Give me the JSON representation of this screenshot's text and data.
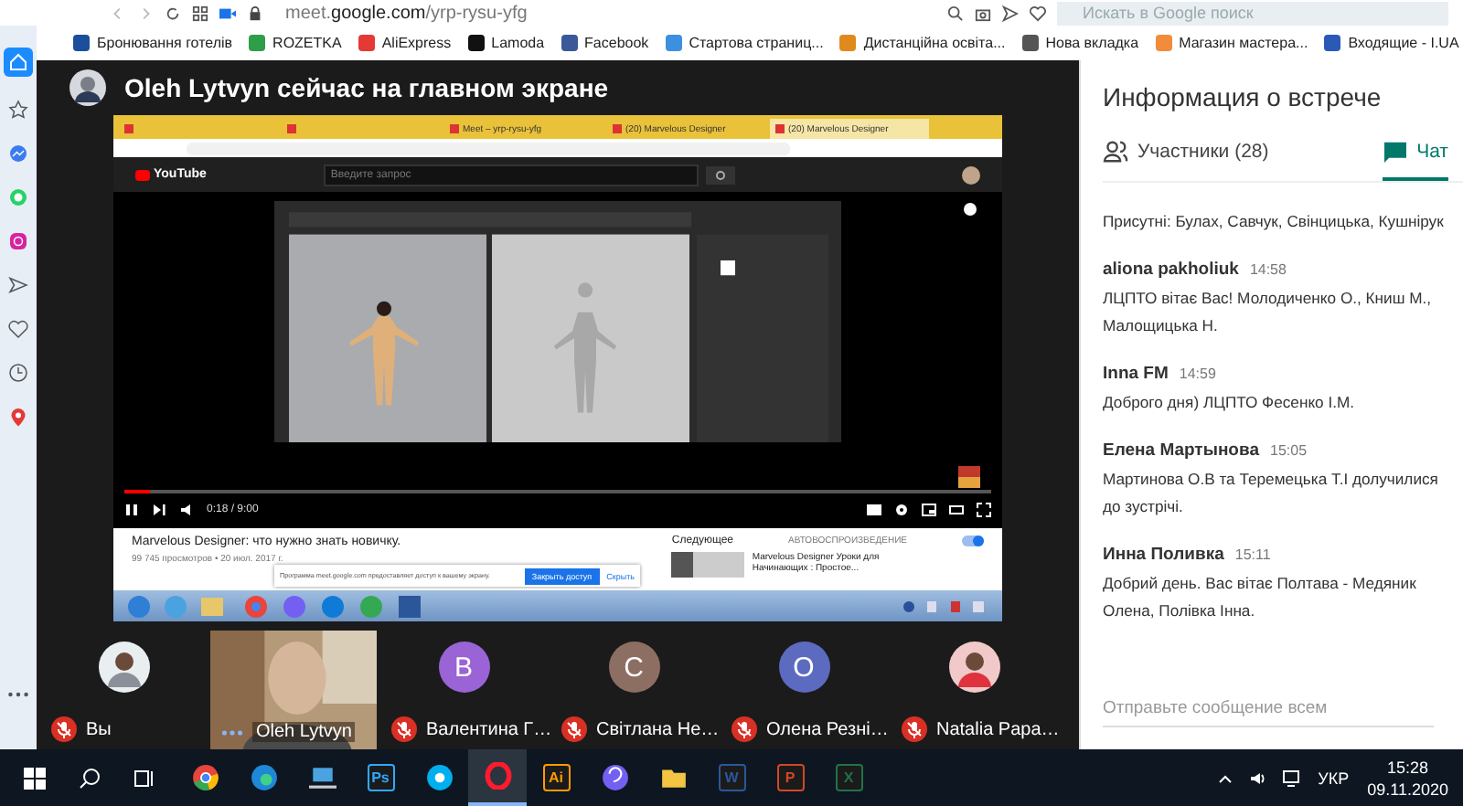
{
  "browser": {
    "address": "meet.**google.com**/yrp-rysu-yfg",
    "search_placeholder": "Искать в Google поиск"
  },
  "bookmarks": [
    {
      "label": "Бронювання готелів"
    },
    {
      "label": "ROZETKA"
    },
    {
      "label": "AliExpress"
    },
    {
      "label": "Lamoda"
    },
    {
      "label": "Facebook"
    },
    {
      "label": "Стартова страниц..."
    },
    {
      "label": "Дистанційна освіта..."
    },
    {
      "label": "Нова вкладка"
    },
    {
      "label": "Магазин мастера..."
    },
    {
      "label": "Входящие - I.UA"
    }
  ],
  "presenter": {
    "title": "Oleh Lytvyn сейчас на главном экране"
  },
  "shared_screen": {
    "tabs": [
      {
        "selected": false
      },
      {
        "selected": false
      },
      {
        "label": "Meet – yrp-rysu-yfg",
        "selected": false
      },
      {
        "label": "(20) Marvelous Designer",
        "selected": false
      },
      {
        "label": "(20) Marvelous Designer",
        "selected": true
      }
    ],
    "logo": "YouTube",
    "search_placeholder": "Введите запрос",
    "time": "0:18 / 9:00",
    "level": 0.03,
    "video_title": "Marvelous Designer: что нужно знать новичку.",
    "video_meta": "99 745 просмотров • 20 июл. 2017 г.",
    "up_next": "Следующее",
    "autoplay": "АВТОВОСПРОИЗВЕДЕНИЕ",
    "autoplay_on": true,
    "next_video": "Marvelous Designer Уроки для Начинающих : Простое...",
    "banner": {
      "text": "Программа meet.google.com предоставляет доступ к вашему экрану.",
      "stop": "Закрыть доступ",
      "hide": "Скрыть"
    }
  },
  "participants": [
    {
      "name": "Вы",
      "muted": true
    },
    {
      "name": "Oleh Lytvyn",
      "kind": "video",
      "muted": false
    },
    {
      "name": "Валентина Г…",
      "kind": "letter",
      "letter": "В",
      "color": "#9a63d6",
      "muted": true
    },
    {
      "name": "Світлана Не…",
      "kind": "letter",
      "letter": "С",
      "color": "#8d6e63",
      "muted": true
    },
    {
      "name": "Олена Резні…",
      "kind": "letter",
      "letter": "О",
      "color": "#5c6bc0",
      "muted": true
    },
    {
      "name": "Natalia Papa…",
      "muted": true
    }
  ],
  "panel": {
    "title": "Информация о встрече",
    "tabs": [
      {
        "label": "Участники (28)",
        "kind": "people",
        "selected": false
      },
      {
        "label": "Чат",
        "kind": "chat",
        "selected": true
      }
    ],
    "messages": [
      {
        "text": "Присутні: Булах, Савчук, Свінцицька, Кушнірук"
      },
      {
        "author": "aliona pakholiuk",
        "time": "14:58",
        "text": "ЛЦПТО вітає Вас! Молодиченко О., Книш М., Малощицька Н."
      },
      {
        "author": "Inna FM",
        "time": "14:59",
        "text": "Доброго дня) ЛЦПТО Фесенко І.М."
      },
      {
        "author": "Елена Мартынова",
        "time": "15:05",
        "text": "Мартинова О.В та Теремецька Т.І долучилися до зустрічі."
      },
      {
        "author": "Инна Поливка",
        "time": "15:11",
        "text": "Добрий день. Вас вітає Полтава - Медяник Олена, Полівка Інна."
      }
    ],
    "placeholder": "Отправьте сообщение всем"
  },
  "taskbar": {
    "apps": [
      {
        "kind": "chrome",
        "active": false
      },
      {
        "kind": "edge",
        "active": false
      },
      {
        "kind": "laptop",
        "active": false
      },
      {
        "kind": "badge",
        "label": "Ps",
        "color": "#31a8ff",
        "active": false
      },
      {
        "kind": "skype",
        "active": false
      },
      {
        "kind": "opera",
        "active": true
      },
      {
        "kind": "badge",
        "label": "Ai",
        "color": "#ff9a00",
        "active": false
      },
      {
        "kind": "viber",
        "active": false
      },
      {
        "kind": "folder",
        "active": false
      },
      {
        "kind": "badge",
        "label": "W",
        "color": "#2b579a",
        "active": false
      },
      {
        "kind": "badge",
        "label": "P",
        "color": "#d24726",
        "active": false
      },
      {
        "kind": "badge",
        "label": "X",
        "color": "#217346",
        "active": false
      }
    ],
    "language": "УКР",
    "time": "15:28",
    "date": "09.11.2020"
  }
}
